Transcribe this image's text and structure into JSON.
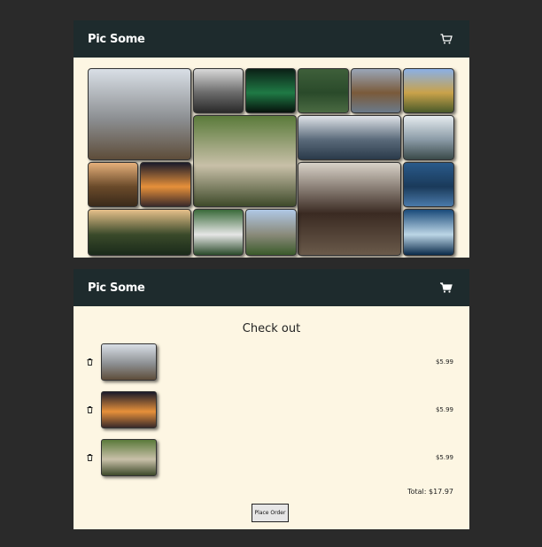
{
  "app": {
    "brand": "Pic Some"
  },
  "icons": {
    "cart": "cart-icon",
    "trash": "trash-icon"
  },
  "gallery": {
    "photos": [
      {
        "name": "bear-photo",
        "colors": [
          "#d9dfe6",
          "#8c8f92",
          "#5e4d3a"
        ]
      },
      {
        "name": "foggy-forest-photo",
        "colors": [
          "#d9d9d9",
          "#6a6a6a",
          "#2a2a2a"
        ]
      },
      {
        "name": "aurora-photo",
        "colors": [
          "#0b2016",
          "#1f7a45",
          "#06120b"
        ]
      },
      {
        "name": "moss-photo",
        "colors": [
          "#3e5f3a",
          "#2a4a2a",
          "#4a6a42"
        ]
      },
      {
        "name": "eagle-photo",
        "colors": [
          "#9aa6b8",
          "#7a5a3a",
          "#6b7a8a"
        ]
      },
      {
        "name": "feet-field-photo",
        "colors": [
          "#8ab0e6",
          "#c9a24a",
          "#4a5a2a"
        ]
      },
      {
        "name": "pug-blanket-photo",
        "colors": [
          "#5a7a3a",
          "#c8c0a8",
          "#3e4a2a"
        ]
      },
      {
        "name": "skyscraper-photo",
        "colors": [
          "#dfe3e8",
          "#5a6a7a",
          "#2a3a4a"
        ]
      },
      {
        "name": "city-skyline-photo",
        "colors": [
          "#e6ecef",
          "#8a9aa6",
          "#3a4a4a"
        ]
      },
      {
        "name": "sunset-trees-photo",
        "colors": [
          "#e6b07a",
          "#6a4a2a",
          "#3a2a1a"
        ]
      },
      {
        "name": "road-sunset-photo",
        "colors": [
          "#1a1a2a",
          "#e6903a",
          "#3a2a2a"
        ]
      },
      {
        "name": "woman-portrait-photo",
        "colors": [
          "#d8d2c8",
          "#3a2a22",
          "#6a5a4a"
        ]
      },
      {
        "name": "ocean-waves-photo",
        "colors": [
          "#2a5a8a",
          "#1a3a5a",
          "#4a7aaa"
        ]
      },
      {
        "name": "mountain-sunset-photo",
        "colors": [
          "#e6c08a",
          "#3a4a2a",
          "#1a2a1a"
        ]
      },
      {
        "name": "waterfall-photo",
        "colors": [
          "#3a6a3a",
          "#e6e6e6",
          "#2a4a2a"
        ]
      },
      {
        "name": "castle-photo",
        "colors": [
          "#b0c8e6",
          "#8a8a7a",
          "#3a5a2a"
        ]
      },
      {
        "name": "ocean-swell-photo",
        "colors": [
          "#1a4a7a",
          "#bcd6e6",
          "#0a2a4a"
        ]
      }
    ]
  },
  "checkout": {
    "title": "Check out",
    "items": [
      {
        "name": "bear-photo",
        "price": "$5.99",
        "colors": [
          "#d9dfe6",
          "#8c8f92",
          "#5e4d3a"
        ]
      },
      {
        "name": "road-sunset-photo",
        "price": "$5.99",
        "colors": [
          "#1a1a2a",
          "#e6903a",
          "#3a2a2a"
        ]
      },
      {
        "name": "pug-blanket-photo",
        "price": "$5.99",
        "colors": [
          "#5a7a3a",
          "#c8c0a8",
          "#3e4a2a"
        ]
      }
    ],
    "total": "Total: $17.97",
    "place_order": "Place Order"
  }
}
